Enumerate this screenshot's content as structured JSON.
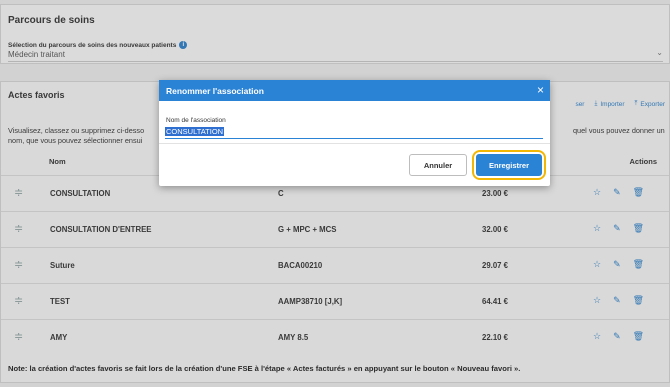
{
  "parcours": {
    "title": "Parcours de soins",
    "sublabel": "Sélection du parcours de soins des nouveaux patients",
    "selected": "Médecin traitant"
  },
  "favoris": {
    "title": "Actes favoris",
    "actions": [
      "ser",
      "Importer",
      "Exporter"
    ],
    "desc_left": "Visualisez, classez ou supprimez ci-desso\nnom, que vous pouvez sélectionner ensui",
    "desc_right": "quel vous pouvez donner un",
    "col_nom": "Nom",
    "col_actions": "Actions",
    "rows": [
      {
        "nom": "CONSULTATION",
        "code": "C",
        "price": "23.00 €"
      },
      {
        "nom": "CONSULTATION D'ENTREE",
        "code": "G + MPC + MCS",
        "price": "32.00 €"
      },
      {
        "nom": "Suture",
        "code": "BACA00210",
        "price": "29.07 €"
      },
      {
        "nom": "TEST",
        "code": "AAMP38710 [J,K]",
        "price": "64.41 €"
      },
      {
        "nom": "AMY",
        "code": "AMY 8.5",
        "price": "22.10 €"
      }
    ],
    "note": "Note: la création d'actes favoris se fait lors de la création d'une FSE à l'étape « Actes facturés » en appuyant sur le bouton « Nouveau favori »."
  },
  "modal": {
    "title": "Renommer l'association",
    "field_label": "Nom de l'association",
    "field_value": "CONSULTATION",
    "cancel": "Annuler",
    "save": "Enregistrer",
    "close": "×"
  },
  "colors": {
    "accent": "#2b83d6",
    "highlight": "#f2b705"
  }
}
